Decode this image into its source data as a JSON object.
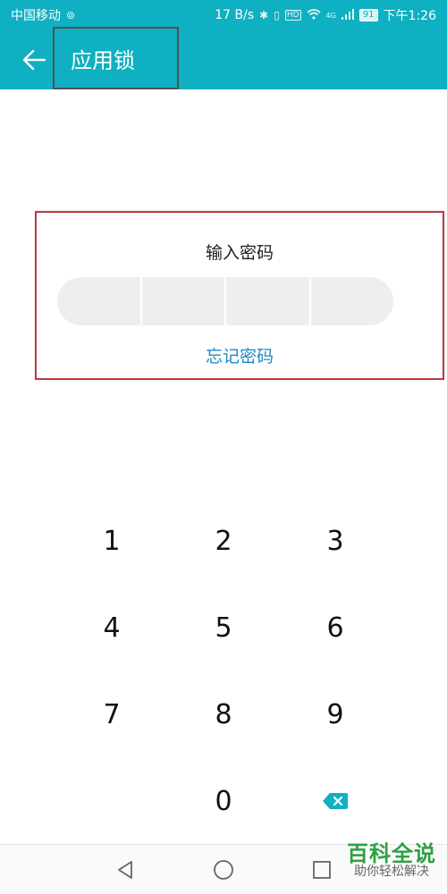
{
  "status_bar": {
    "carrier": "中国移动",
    "speed": "17 B/s",
    "hd_badge": "HD",
    "network": "4G",
    "battery": "91",
    "time": "下午1:26"
  },
  "app_bar": {
    "title": "应用锁",
    "back_icon": "arrow-left-icon"
  },
  "password_panel": {
    "title": "输入密码",
    "forgot_label": "忘记密码",
    "pin_slots": 4
  },
  "keypad": {
    "keys": [
      "1",
      "2",
      "3",
      "4",
      "5",
      "6",
      "7",
      "8",
      "9",
      "0"
    ],
    "delete_icon": "backspace-icon"
  },
  "nav_bar": {
    "back": "triangle-back-icon",
    "home": "circle-home-icon",
    "recent": "square-recent-icon"
  },
  "watermark": {
    "title": "百科全说",
    "subtitle": "助你轻松解决"
  },
  "colors": {
    "accent": "#0fb0c1",
    "link": "#1e88c8"
  }
}
